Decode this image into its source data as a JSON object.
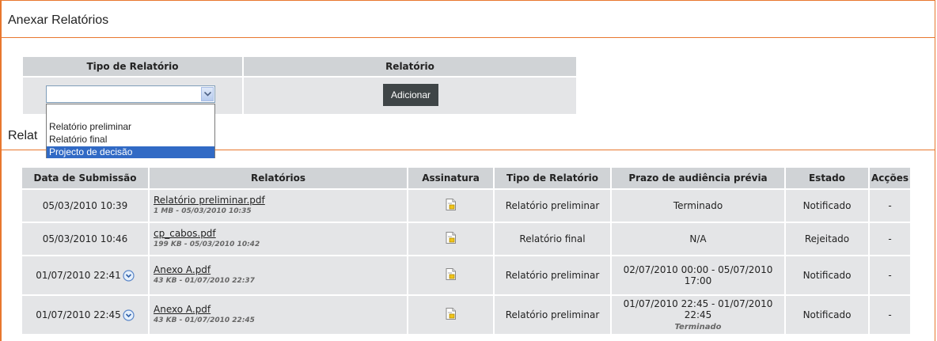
{
  "attach": {
    "title": "Anexar Relatórios",
    "col_tipo": "Tipo de Relatório",
    "col_relatorio": "Relatório",
    "select_value": "",
    "add_button": "Adicionar",
    "options": [
      "Relatório preliminar",
      "Relatório final",
      "Projecto de decisão"
    ],
    "selected_option": "Projecto de decisão"
  },
  "reports": {
    "title": "Relatórios",
    "title_visible": "Relat",
    "headers": [
      "Data de Submissão",
      "Relatórios",
      "Assinatura",
      "Tipo de Relatório",
      "Prazo de audiência prévia",
      "Estado",
      "Acções"
    ],
    "rows": [
      {
        "date": "05/03/2010 10:39",
        "file": "Relatório preliminar.pdf",
        "meta": "1 MB - 05/03/2010 10:35",
        "tipo": "Relatório preliminar",
        "prazo": "Terminado",
        "prazo_note": "",
        "estado": "Notificado",
        "accoes": "-",
        "clock": false
      },
      {
        "date": "05/03/2010 10:46",
        "file": "cp_cabos.pdf",
        "meta": "199 KB - 05/03/2010 10:42",
        "tipo": "Relatório final",
        "prazo": "N/A",
        "prazo_note": "",
        "estado": "Rejeitado",
        "accoes": "-",
        "clock": false
      },
      {
        "date": "01/07/2010 22:41",
        "file": "Anexo A.pdf",
        "meta": "43 KB - 01/07/2010 22:37",
        "tipo": "Relatório preliminar",
        "prazo": "02/07/2010 00:00 - 05/07/2010 17:00",
        "prazo_note": "",
        "estado": "Notificado",
        "accoes": "-",
        "clock": true
      },
      {
        "date": "01/07/2010 22:45",
        "file": "Anexo A.pdf",
        "meta": "43 KB - 01/07/2010 22:45",
        "tipo": "Relatório preliminar",
        "prazo": "01/07/2010 22:45 - 01/07/2010 22:45",
        "prazo_note": "Terminado",
        "estado": "Notificado",
        "accoes": "-",
        "clock": true
      }
    ]
  },
  "colors": {
    "accent": "#e8772e",
    "header_bg": "#d0d3d6",
    "cell_bg": "#e4e5e7",
    "button_bg": "#3f4547",
    "selected": "#316ac5"
  }
}
